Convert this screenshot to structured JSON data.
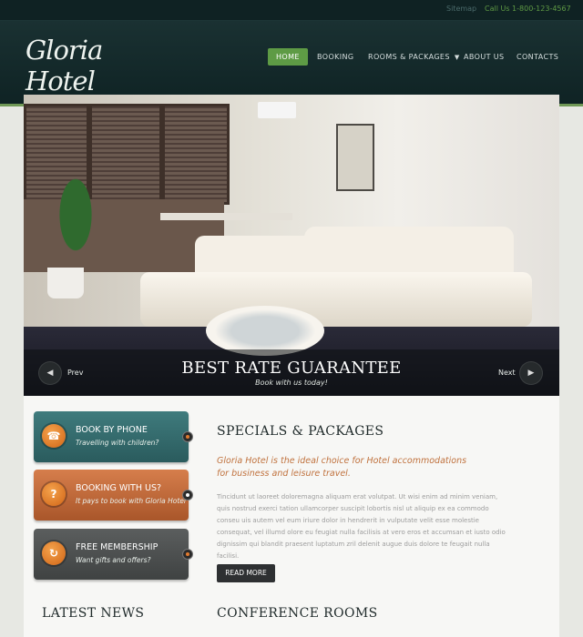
{
  "topbar": {
    "sitemap": "Sitemap",
    "call": "Call Us 1-800-123-4567"
  },
  "logo": {
    "text": "Gloria Hotel"
  },
  "nav": {
    "items": [
      {
        "label": "Home"
      },
      {
        "label": "Booking"
      },
      {
        "label": "Rooms & Packages"
      },
      {
        "label": "About Us"
      },
      {
        "label": "Contacts"
      }
    ]
  },
  "slider": {
    "title": "BEST RATE GUARANTEE",
    "subtitle": "Book with us today!",
    "prev_label": "Prev",
    "next_label": "Next"
  },
  "boxes": [
    {
      "title": "Book by Phone",
      "subtitle": "Travelling with children?",
      "icon": "phone-icon"
    },
    {
      "title": "Booking with us?",
      "subtitle": "It pays to book with Gloria Hotel",
      "icon": "question-icon"
    },
    {
      "title": "Free Membership",
      "subtitle": "Want gifts and offers?",
      "icon": "refresh-icon"
    }
  ],
  "specials": {
    "title": "Specials & Packages",
    "lead": "Gloria Hotel is the ideal choice for Hotel accommodations for business and leisure travel.",
    "text": "Tincidunt ut laoreet doloremagna aliquam erat volutpat. Ut wisi enim ad minim veniam, quis nostrud exerci tation ullamcorper suscipit lobortis nisl ut aliquip ex ea commodo conseu uis autem vel eum iriure dolor in hendrerit in vulputate velit esse molestie consequat, vel illumd olore eu feugiat nulla facilisis at vero eros et accumsan et iusto odio dignissim qui blandit praesent luptatum zril delenit augue duis dolore te feugait nulla facilisi.",
    "read_more": "Read more"
  },
  "bottom": {
    "latest_news": "Latest News",
    "conference": "Conference Rooms"
  },
  "colors": {
    "accent_green": "#5e9b45",
    "box_teal": "#3f7b7d",
    "box_orange": "#d67e4c",
    "box_gray": "#5b5e5e"
  }
}
